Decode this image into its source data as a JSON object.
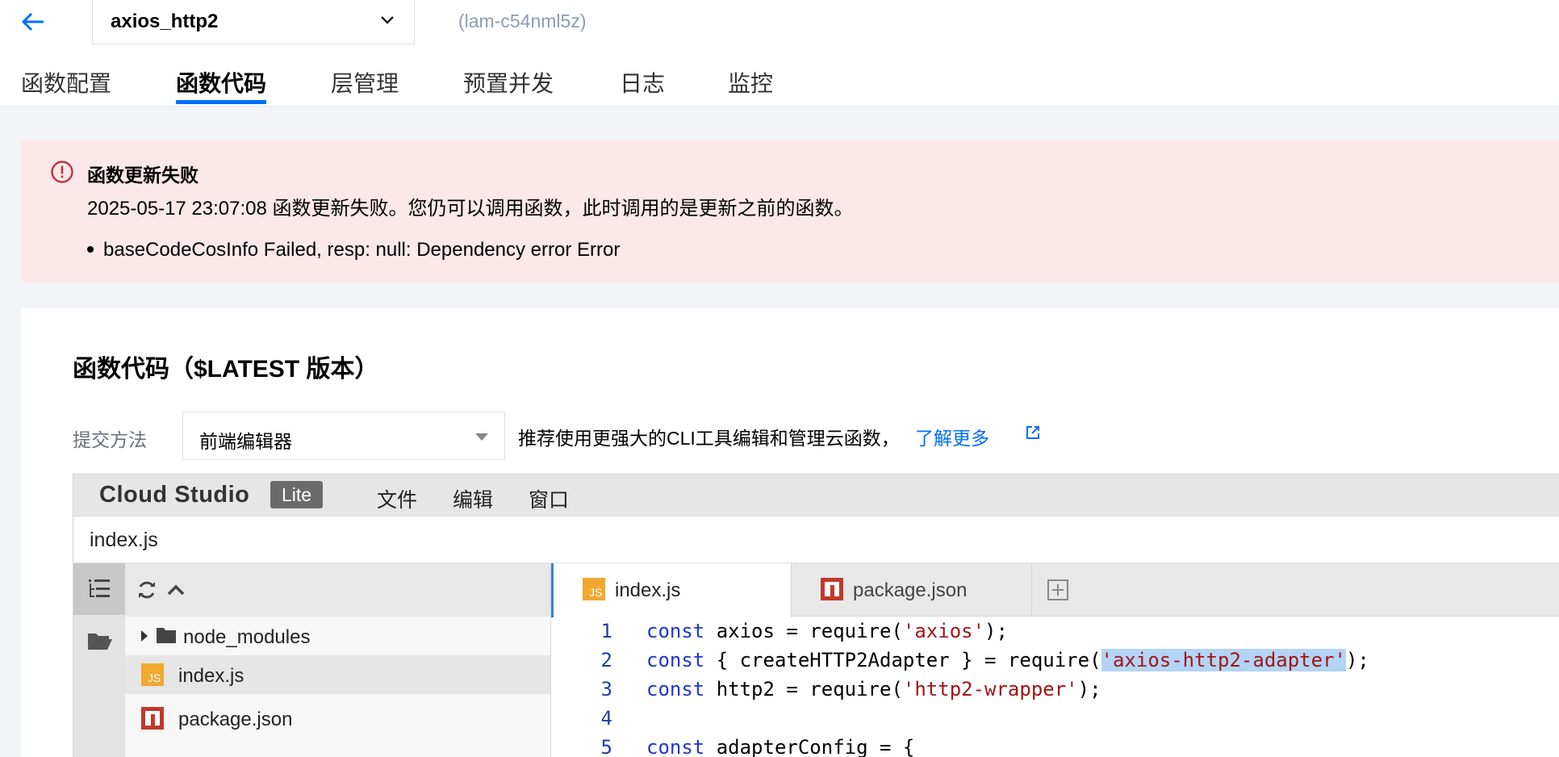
{
  "header": {
    "function_name": "axios_http2",
    "function_id": "(lam-c54nml5z)",
    "tabs": [
      {
        "label": "函数配置",
        "active": false
      },
      {
        "label": "函数代码",
        "active": true
      },
      {
        "label": "层管理",
        "active": false
      },
      {
        "label": "预置并发",
        "active": false
      },
      {
        "label": "日志",
        "active": false
      },
      {
        "label": "监控",
        "active": false
      }
    ]
  },
  "alert": {
    "title": "函数更新失败",
    "message": "2025-05-17 23:07:08 函数更新失败。您仍可以调用函数，此时调用的是更新之前的函数。",
    "detail": "baseCodeCosInfo Failed, resp: null: Dependency error Error",
    "color": "#fce8e9",
    "icon_color": "#c3303d"
  },
  "code_panel": {
    "title": "函数代码（$LATEST 版本）",
    "submit_label": "提交方法",
    "submit_value": "前端编辑器",
    "hint": "推荐使用更强大的CLI工具编辑和管理云函数，",
    "learn_more": "了解更多"
  },
  "ide": {
    "brand": "Cloud Studio",
    "badge": "Lite",
    "menus": [
      "文件",
      "编辑",
      "窗口"
    ],
    "path": "index.js",
    "tree": [
      {
        "label": "node_modules",
        "icon": "folder-icon"
      },
      {
        "label": "index.js",
        "icon": "js-file-icon"
      },
      {
        "label": "package.json",
        "icon": "npm-icon"
      }
    ],
    "tabs": [
      {
        "label": "index.js",
        "icon": "js-file-icon",
        "active": true
      },
      {
        "label": "package.json",
        "icon": "npm-icon",
        "active": false
      }
    ],
    "code_lines": [
      {
        "n": "1"
      },
      {
        "n": "2"
      },
      {
        "n": "3"
      },
      {
        "n": "4"
      },
      {
        "n": "5"
      }
    ],
    "code": {
      "l1_kw": "const",
      "l1_a": " axios = require(",
      "l1_s": "'axios'",
      "l1_b": ");",
      "l2_kw": "const",
      "l2_a": " { createHTTP2Adapter } = require(",
      "l2_s": "'axios-http2-adapter'",
      "l2_b": ");",
      "l3_kw": "const",
      "l3_a": " http2 = require(",
      "l3_s": "'http2-wrapper'",
      "l3_b": ");",
      "l5_kw": "const",
      "l5_a": " adapterConfig = {"
    }
  },
  "colors": {
    "accent": "#006eff",
    "keyword": "#1f36c8",
    "string": "#a31515"
  }
}
